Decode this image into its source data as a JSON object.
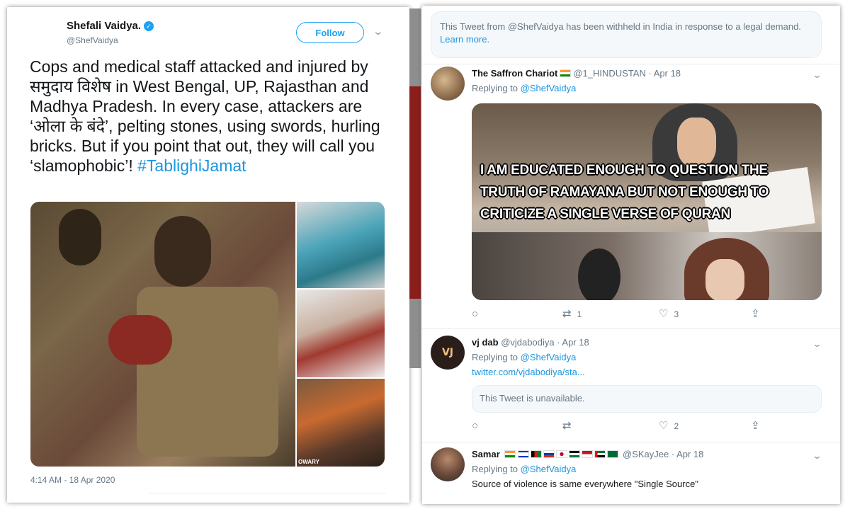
{
  "main_tweet": {
    "author_name": "Shefali Vaidya.",
    "author_handle": "@ShefVaidya",
    "follow_label": "Follow",
    "text": "Cops and medical staff attacked and injured by समुदाय विशेष in West Bengal, UP, Rajasthan and Madhya Pradesh. In every case, attackers are ‘ओला के बंदे’, pelting stones, using swords, hurling bricks. But if you point that out, they will call you ‘slamophobic’! ",
    "hashtag": "#TablighiJamat",
    "image_caption": "OWARY",
    "timestamp": "4:14 AM - 18 Apr 2020"
  },
  "withheld_notice": {
    "text": "This Tweet from @ShefVaidya has been withheld in India in response to a legal demand. ",
    "link": "Learn more."
  },
  "replies": [
    {
      "name": "The Saffron Chariot",
      "handle": "@1_HINDUSTAN",
      "date": "· Apr 18",
      "replying_prefix": "Replying to ",
      "replying_to": "@ShefVaidya",
      "meme_lines": [
        "I AM EDUCATED ENOUGH TO QUESTION THE",
        "TRUTH OF RAMAYANA BUT NOT ENOUGH TO",
        "CRITICIZE A SINGLE VERSE OF QURAN"
      ],
      "retweets": "1",
      "likes": "3"
    },
    {
      "name": "vj dab",
      "handle": "@vjdabodiya",
      "date": "· Apr 18",
      "avatar_text": "VJ DAB",
      "replying_prefix": "Replying to ",
      "replying_to": "@ShefVaidya",
      "link": "twitter.com/vjdabodiya/sta...",
      "quoted_text": "This Tweet is unavailable.",
      "retweets": "",
      "likes": "2"
    },
    {
      "name": "Samar",
      "handle": "@SKayJee",
      "date": "· Apr 18",
      "replying_prefix": "Replying to ",
      "replying_to": "@ShefVaidya",
      "text": "Source of violence is same everywhere \"Single Source\""
    }
  ],
  "colors": {
    "twitter_blue": "#1da1f2",
    "link_blue": "#1b95e0",
    "secondary_text": "#657786"
  },
  "icons": [
    "verified-icon",
    "chevron-down-icon",
    "reply-icon",
    "retweet-icon",
    "like-icon",
    "share-icon"
  ]
}
